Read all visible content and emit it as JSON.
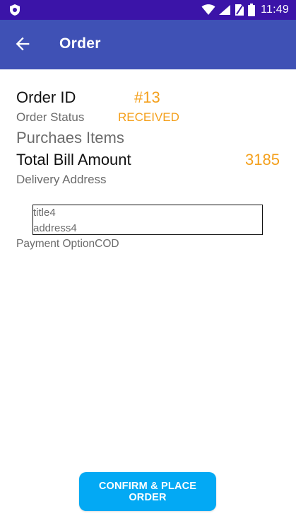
{
  "status_bar": {
    "time": "11:49",
    "icons": [
      "app-shield-icon",
      "wifi-icon",
      "signal-icon",
      "no-sim-icon",
      "battery-icon"
    ],
    "background_color": "#3b14a8"
  },
  "app_bar": {
    "title": "Order",
    "back_icon": "arrow-left-icon",
    "background_color": "#3f51b5"
  },
  "order": {
    "id_label": "Order ID",
    "id_value": "#13",
    "status_label": "Order Status",
    "status_value": "RECEIVED",
    "purchase_items_label": "Purchaes Items",
    "total_label": "Total Bill Amount",
    "total_value": "3185",
    "delivery_address_label": "Delivery Address",
    "address": {
      "title": "title4",
      "line": "address4"
    },
    "payment_label": "Payment Option",
    "payment_value": "COD",
    "accent_color": "#f4a01c"
  },
  "actions": {
    "confirm_label": "CONFIRM & PLACE ORDER",
    "confirm_color": "#03a9f4"
  }
}
